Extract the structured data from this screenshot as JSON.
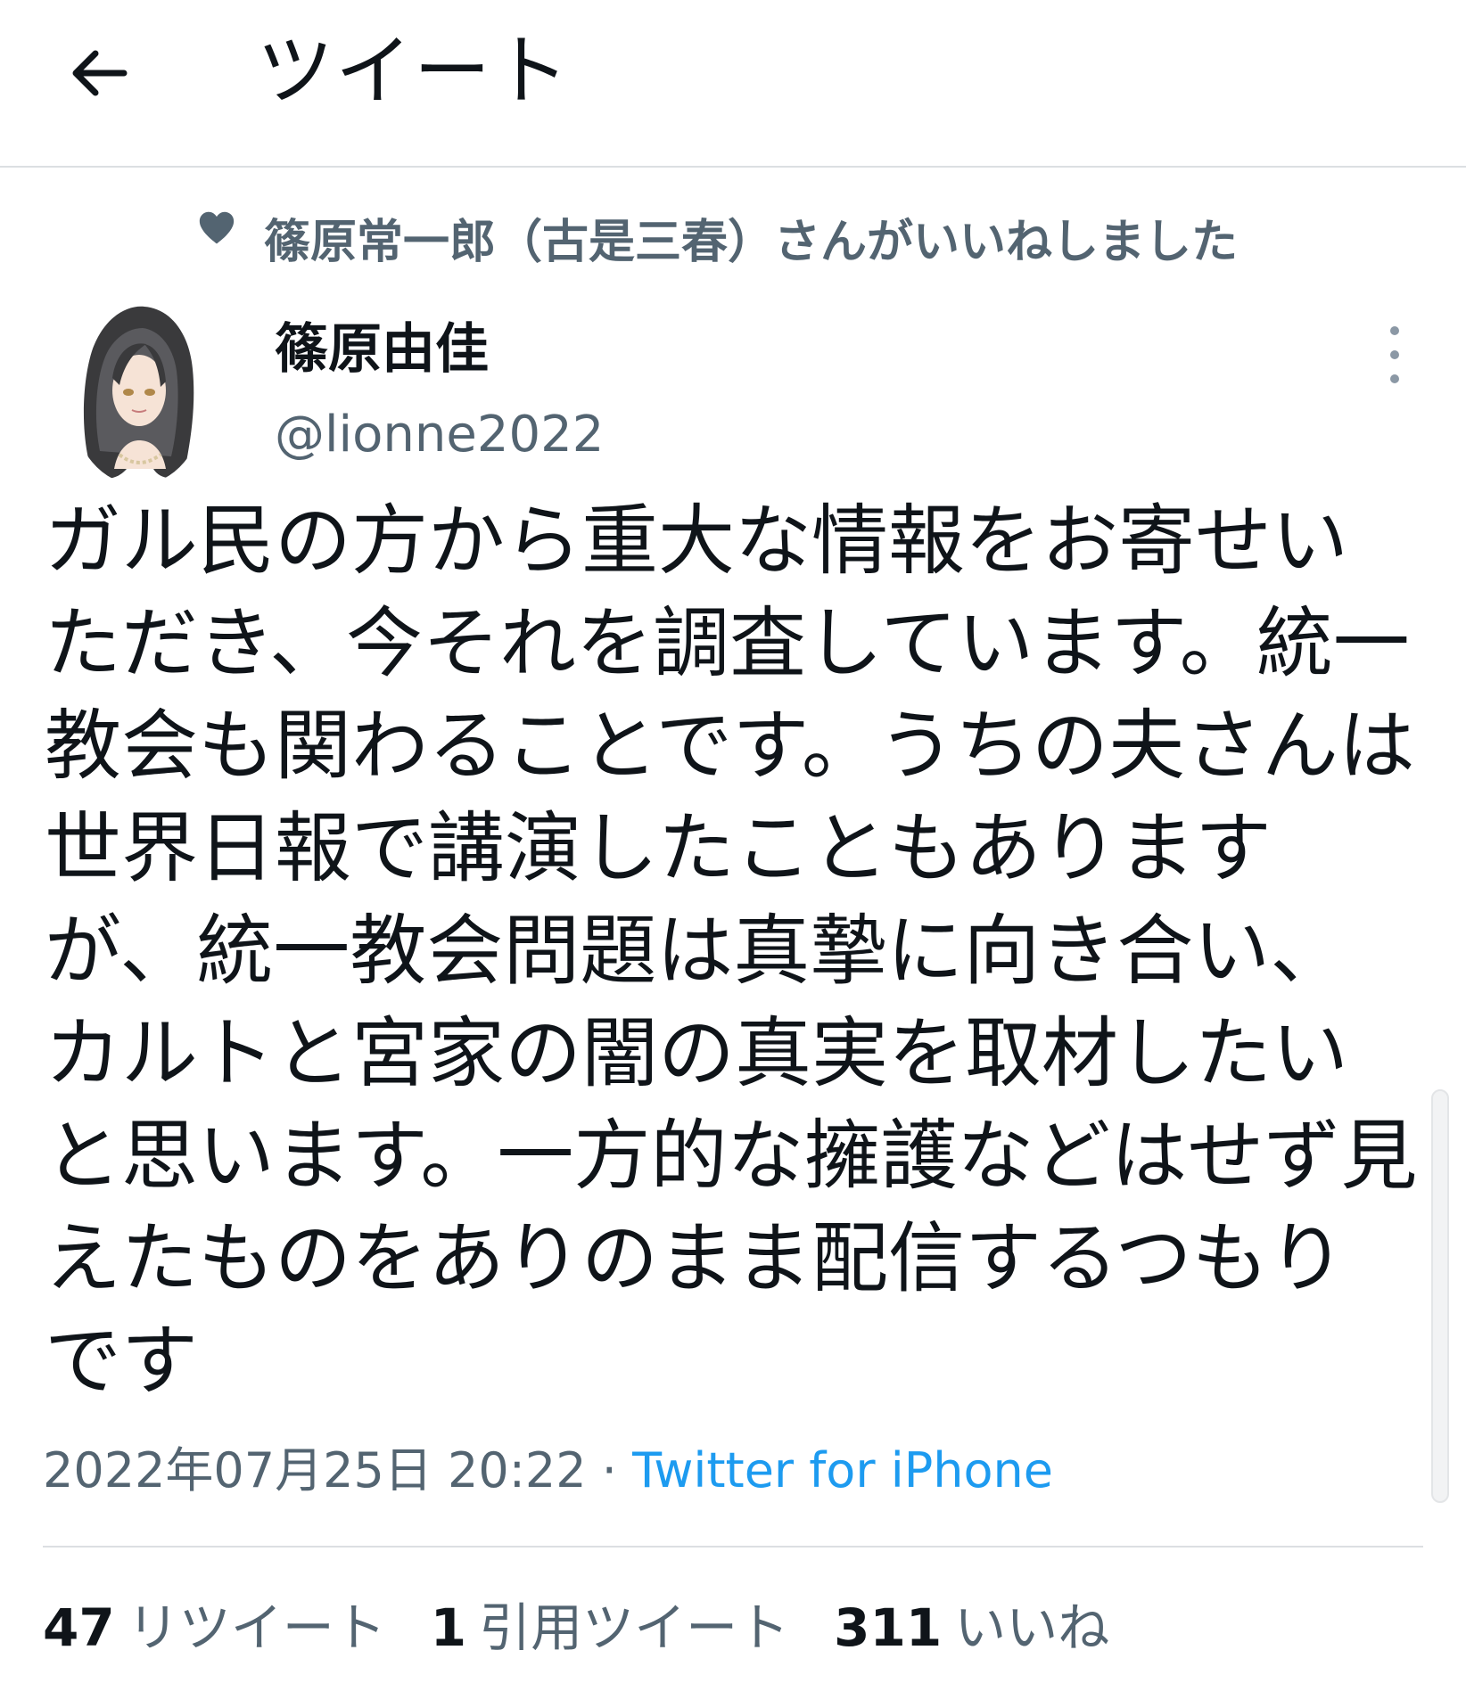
{
  "header": {
    "title": "ツイート",
    "back_icon": "arrow-left-icon"
  },
  "social_context": {
    "icon": "heart-icon",
    "text": "篠原常一郎（古是三春）さんがいいねしました"
  },
  "author": {
    "display_name": "篠原由佳",
    "handle": "@lionne2022"
  },
  "tweet": {
    "text": "ガル民の方から重大な情報をお寄せいただき、今それを調査しています。統一教会も関わることです。うちの夫さんは世界日報で講演したこともありますが、統一教会問題は真摯に向き合い、カルトと宮家の闇の真実を取材したいと思います。一方的な擁護などはせず見えたものをありのまま配信するつもりです",
    "timestamp": "2022年07月25日 20:22",
    "separator": " · ",
    "source": "Twitter for iPhone"
  },
  "stats": {
    "retweets_count": "47",
    "retweets_label": "リツイート",
    "quotes_count": "1",
    "quotes_label": "引用ツイート",
    "likes_count": "311",
    "likes_label": "いいね"
  },
  "colors": {
    "text_primary": "#0f1419",
    "text_secondary": "#536471",
    "link": "#1d9bf0",
    "divider": "#dcdfe2"
  }
}
